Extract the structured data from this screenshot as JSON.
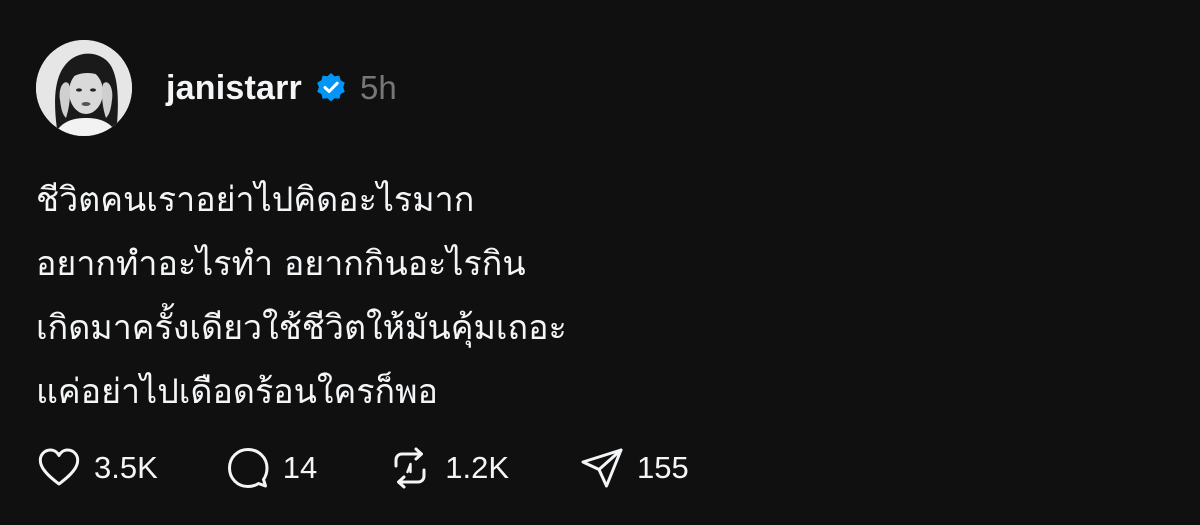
{
  "post": {
    "username": "janistarr",
    "timestamp": "5h",
    "verified": true,
    "lines": [
      "ชีวิตคนเราอย่าไปคิดอะไรมาก",
      "อยากทำอะไรทำ อยากกินอะไรกิน",
      "เกิดมาครั้งเดียวใช้ชีวิตให้มันคุ้มเถอะ",
      "แค่อย่าไปเดือดร้อนใครก็พอ"
    ]
  },
  "actions": {
    "likes": "3.5K",
    "replies": "14",
    "reposts": "1.2K",
    "shares": "155"
  },
  "icons": {
    "like": "heart-icon",
    "reply": "comment-bubble-icon",
    "repost": "repost-icon",
    "share": "send-icon",
    "verified": "verified-badge-icon"
  },
  "colors": {
    "background": "#101010",
    "text": "#f3f5f7",
    "muted": "#777777",
    "verified": "#0095f6"
  }
}
